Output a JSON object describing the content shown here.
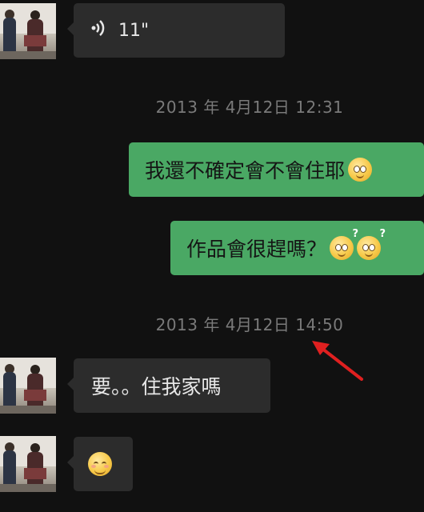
{
  "messages": [
    {
      "id": "m1",
      "direction": "incoming",
      "type": "voice",
      "duration": "11\""
    },
    {
      "id": "ts1",
      "type": "timestamp",
      "text": "2013 年 4月12日 12:31"
    },
    {
      "id": "m2",
      "direction": "outgoing",
      "text": "我還不確定會不會住耶",
      "emoji": "worried-face"
    },
    {
      "id": "m3",
      "direction": "outgoing",
      "text": "作品會很趕嗎？",
      "emoji": "confused-face"
    },
    {
      "id": "ts2",
      "type": "timestamp",
      "text": "2013 年 4月12日 14:50"
    },
    {
      "id": "m4",
      "direction": "incoming",
      "text": "要。。住我家嗎"
    },
    {
      "id": "m5",
      "direction": "incoming",
      "emoji": "smiling-face"
    }
  ],
  "colors": {
    "background": "#111111",
    "incoming_bubble": "#2c2c2c",
    "outgoing_bubble": "#4aa864",
    "timestamp": "#7a7a7a",
    "annotation_arrow": "#e02020"
  }
}
